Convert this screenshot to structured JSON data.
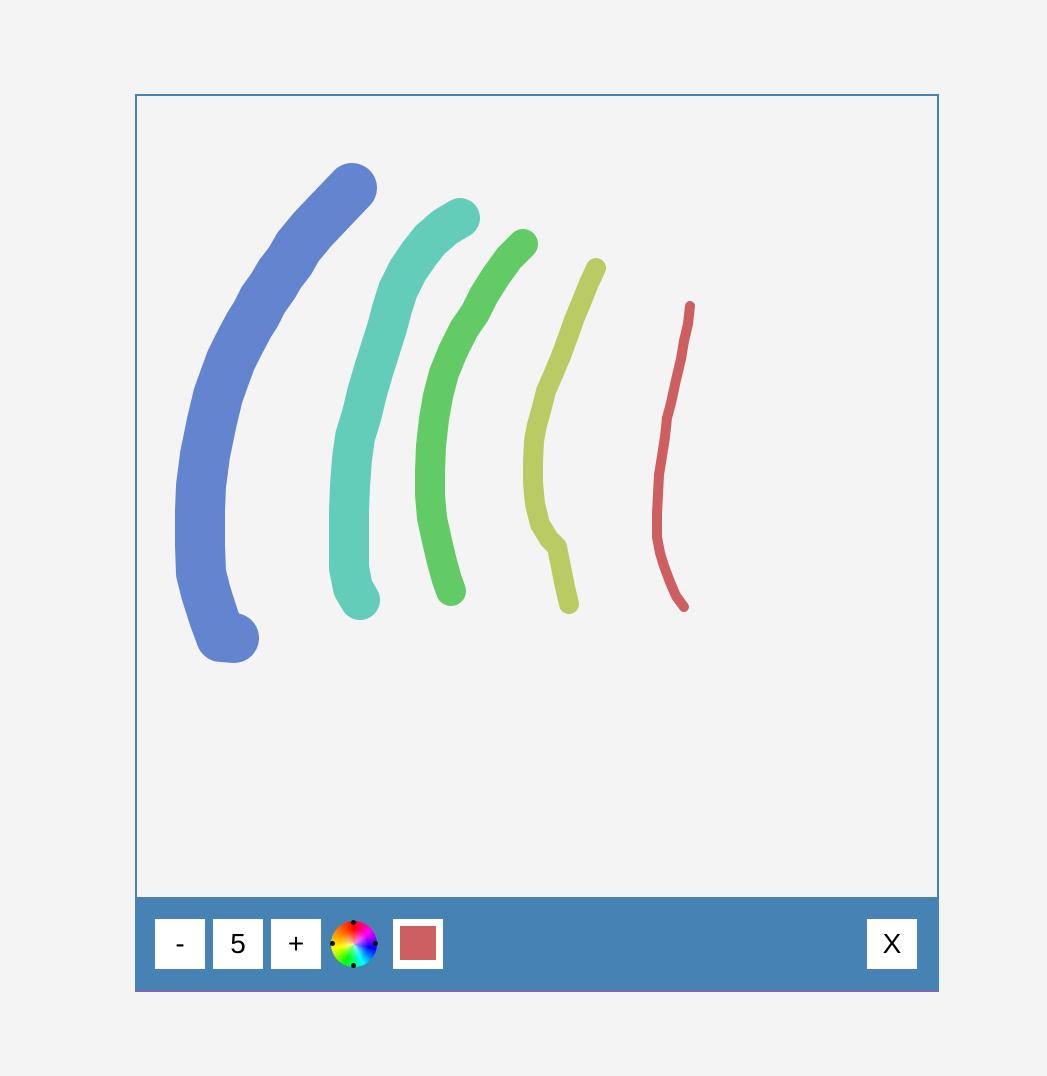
{
  "toolbar": {
    "minus_label": "-",
    "brush_size": "5",
    "plus_label": "+",
    "close_label": "X",
    "current_color": "#cd5f61"
  },
  "colors": {
    "frame": "#4682b4",
    "background": "#f4f4f4"
  },
  "strokes": [
    {
      "color": "#6384cf",
      "width": 50
    },
    {
      "color": "#63cdba",
      "width": 40
    },
    {
      "color": "#63cb66",
      "width": 30
    },
    {
      "color": "#bacb63",
      "width": 20
    },
    {
      "color": "#cd5f61",
      "width": 10
    }
  ]
}
